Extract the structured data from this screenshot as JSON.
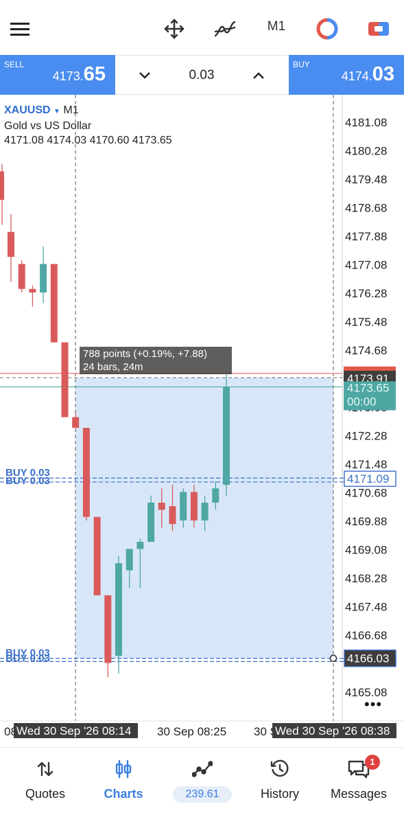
{
  "toolbar": {
    "menu_icon": "hamburger-menu-icon",
    "move_icon": "crosshair-move-icon",
    "indicators_icon": "indicators-icon",
    "timeframe": "M1",
    "color_icon": "color-scheme-icon",
    "trade_icon": "one-click-trade-icon"
  },
  "trade": {
    "sell": {
      "label": "SELL",
      "price_main": "4173.",
      "price_big": "65"
    },
    "buy": {
      "label": "BUY",
      "price_main": "4174.",
      "price_big": "03"
    },
    "volume": "0.03"
  },
  "symbol": {
    "name": "XAUUSD",
    "timeframe": "M1",
    "description": "Gold vs US Dollar",
    "ohlc": "4171.08 4174.03 4170.60 4173.65"
  },
  "measure": {
    "line1": "788 points (+0.19%, +7.88)",
    "line2": "24 bars, 24m"
  },
  "price_tags": {
    "crosshair": "4173.91",
    "bid": "4173.65",
    "timer": "00:00",
    "order_upper": "4171.09",
    "order_lower": "4166.03",
    "hidden_ask": "4174.03"
  },
  "order_labels": {
    "upper_a": "BUY 0.03",
    "upper_b": "BUY 0.03",
    "lower_a": "BUY 0.03",
    "lower_b": "BUY 0.03"
  },
  "time_axis": {
    "left_partial": "08",
    "left_highlight": "Wed 30 Sep '26 08:14",
    "middle": "30 Sep 08:25",
    "right_partial": "30 S",
    "right_highlight": "Wed 30 Sep '26 08:38"
  },
  "more_icon": "more-dots-icon",
  "chart_data": {
    "type": "candlestick",
    "y_ticks": [
      "4181.08",
      "4180.28",
      "4179.48",
      "4178.68",
      "4177.88",
      "4177.08",
      "4176.28",
      "4175.48",
      "4174.68",
      "4173.08",
      "4172.28",
      "4171.48",
      "4170.68",
      "4169.88",
      "4169.08",
      "4168.28",
      "4167.48",
      "4166.68",
      "4165.08"
    ],
    "ylim": [
      4164.6,
      4181.6
    ],
    "candles": [
      {
        "o": 4178.0,
        "h": 4178.5,
        "l": 4176.6,
        "c": 4177.3
      },
      {
        "o": 4177.1,
        "h": 4177.2,
        "l": 4176.3,
        "c": 4176.4
      },
      {
        "o": 4176.4,
        "h": 4176.5,
        "l": 4175.9,
        "c": 4176.3
      },
      {
        "o": 4176.3,
        "h": 4177.6,
        "l": 4176.0,
        "c": 4177.1
      },
      {
        "o": 4177.1,
        "h": 4177.1,
        "l": 4174.9,
        "c": 4174.9
      },
      {
        "o": 4174.9,
        "h": 4174.9,
        "l": 4172.8,
        "c": 4172.8
      },
      {
        "o": 4172.8,
        "h": 4172.9,
        "l": 4172.5,
        "c": 4172.5
      },
      {
        "o": 4172.5,
        "h": 4172.5,
        "l": 4169.9,
        "c": 4170.0
      },
      {
        "o": 4170.0,
        "h": 4170.0,
        "l": 4167.8,
        "c": 4167.8
      },
      {
        "o": 4167.8,
        "h": 4167.8,
        "l": 4165.5,
        "c": 4165.9
      },
      {
        "o": 4166.1,
        "h": 4168.9,
        "l": 4165.6,
        "c": 4168.7
      },
      {
        "o": 4168.5,
        "h": 4169.1,
        "l": 4168.0,
        "c": 4169.1
      },
      {
        "o": 4169.1,
        "h": 4169.4,
        "l": 4168.0,
        "c": 4169.3
      },
      {
        "o": 4169.3,
        "h": 4170.6,
        "l": 4169.3,
        "c": 4170.4
      },
      {
        "o": 4170.4,
        "h": 4170.8,
        "l": 4169.7,
        "c": 4170.2
      },
      {
        "o": 4170.3,
        "h": 4170.9,
        "l": 4169.6,
        "c": 4169.8
      },
      {
        "o": 4169.9,
        "h": 4170.8,
        "l": 4169.7,
        "c": 4170.7
      },
      {
        "o": 4170.7,
        "h": 4170.9,
        "l": 4169.7,
        "c": 4169.9
      },
      {
        "o": 4169.9,
        "h": 4170.6,
        "l": 4169.6,
        "c": 4170.4
      },
      {
        "o": 4170.4,
        "h": 4171.0,
        "l": 4170.2,
        "c": 4170.8
      },
      {
        "o": 4170.9,
        "h": 4174.0,
        "l": 4170.6,
        "c": 4173.65
      }
    ],
    "bid": 4173.65,
    "ask": 4174.03,
    "crosshair_price": 4173.91,
    "orders": [
      4171.09,
      4170.98,
      4166.03,
      4165.94
    ],
    "colors": {
      "up": "#4ea7a3",
      "down": "#d95a5a",
      "selection": "#d8e7f8",
      "order": "#3b6fc8"
    }
  },
  "nav": {
    "quotes": {
      "label": "Quotes",
      "icon": "quotes-arrows-icon"
    },
    "charts": {
      "label": "Charts",
      "icon": "candles-chart-icon"
    },
    "trade": {
      "value": "239.61",
      "icon": "trade-trend-icon"
    },
    "history": {
      "label": "History",
      "icon": "history-clock-icon"
    },
    "messages": {
      "label": "Messages",
      "icon": "messages-chat-icon",
      "badge": "1"
    }
  }
}
